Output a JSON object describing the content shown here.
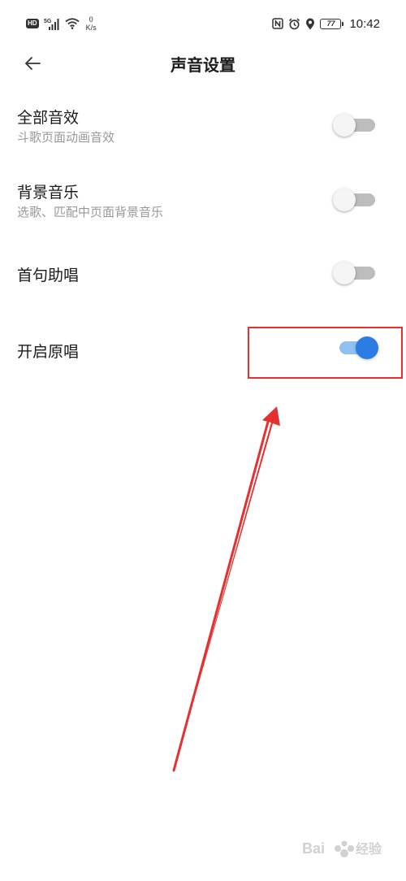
{
  "status_bar": {
    "hd": "HD",
    "signal": "5G",
    "speed_value": "0",
    "speed_unit": "K/s",
    "battery": "77",
    "time": "10:42"
  },
  "header": {
    "title": "声音设置"
  },
  "settings": [
    {
      "title": "全部音效",
      "subtitle": "斗歌页面动画音效",
      "enabled": false
    },
    {
      "title": "背景音乐",
      "subtitle": "选歌、匹配中页面背景音乐",
      "enabled": false
    },
    {
      "title": "首句助唱",
      "subtitle": "",
      "enabled": false
    },
    {
      "title": "开启原唱",
      "subtitle": "",
      "enabled": true
    }
  ],
  "colors": {
    "switch_on_knob": "#2b7de4",
    "switch_on_track": "#8fc0f0",
    "switch_off_track": "#bdbdbd",
    "annotation": "#e53030"
  },
  "watermark": {
    "label": "Bai du 经验"
  }
}
